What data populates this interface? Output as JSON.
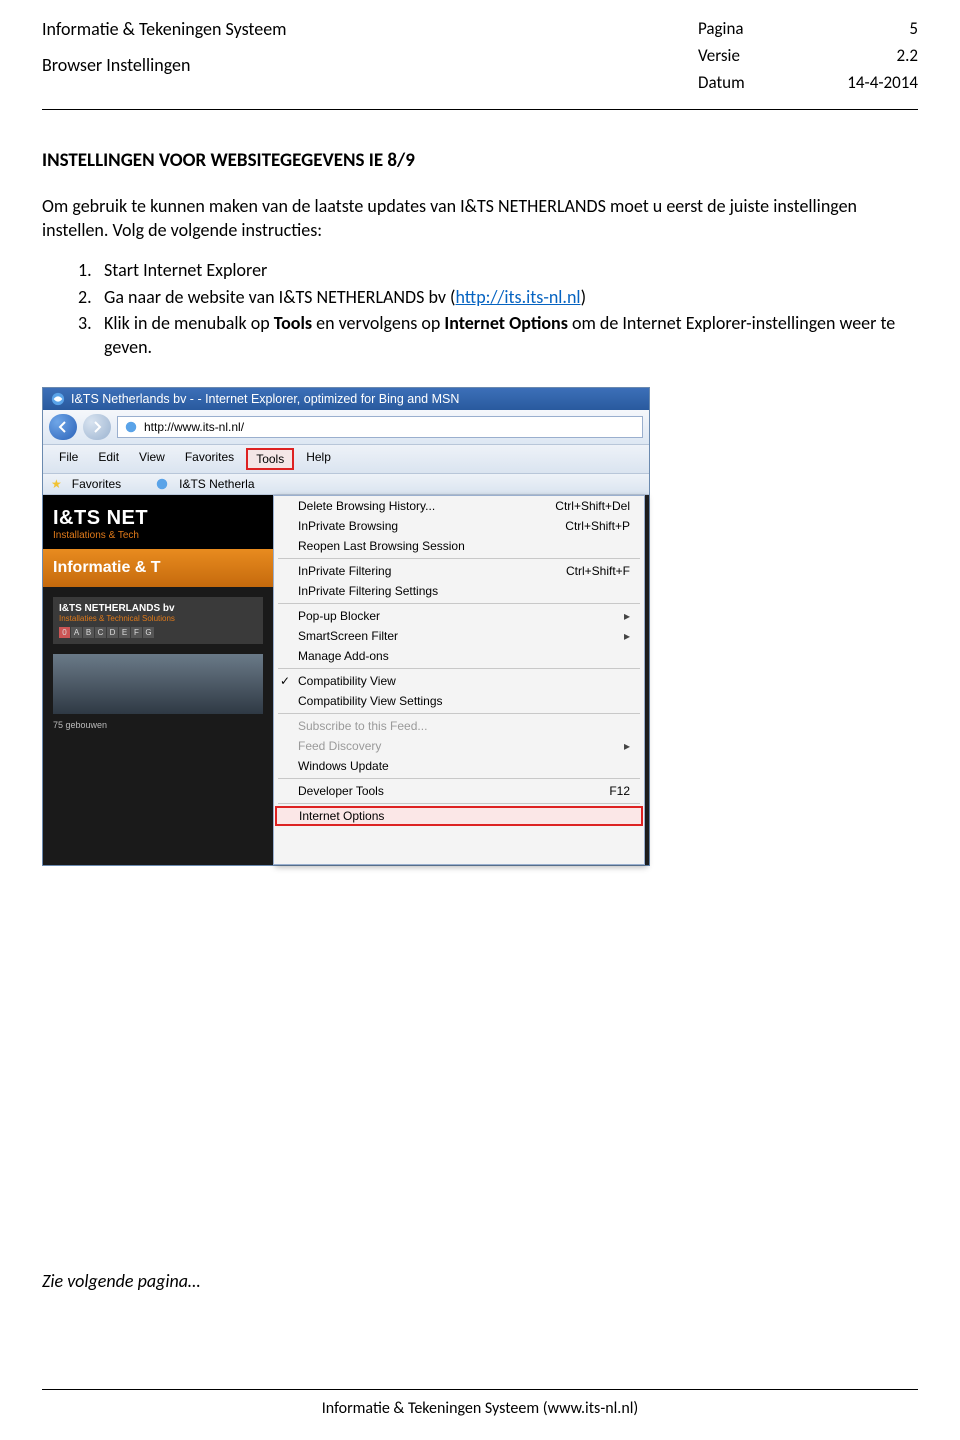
{
  "header": {
    "system": "Informatie & Tekeningen Systeem",
    "subtitle": "Browser Instellingen",
    "rows": [
      {
        "label": "Pagina",
        "value": "5"
      },
      {
        "label": "Versie",
        "value": "2.2"
      },
      {
        "label": "Datum",
        "value": "14-4-2014"
      }
    ]
  },
  "section": {
    "heading": "INSTELLINGEN VOOR WEBSITEGEGEVENS IE 8/9",
    "intro": "Om gebruik te kunnen maken van de laatste updates van I&TS NETHERLANDS moet u eerst de juiste instellingen instellen. Volg de volgende instructies:",
    "steps": {
      "s1": "Start Internet Explorer",
      "s2_pre": "Ga naar de website van I&TS NETHERLANDS bv (",
      "s2_link": "http://its.its-nl.nl",
      "s2_post": ")",
      "s3_a": "Klik in de menubalk op ",
      "s3_b": "Tools",
      "s3_c": " en vervolgens op ",
      "s3_d": "Internet Options",
      "s3_e": " om de Internet Explorer-instellingen weer te geven."
    }
  },
  "ie": {
    "title": "I&TS Netherlands bv - - Internet Explorer, optimized for Bing and MSN",
    "url": "http://www.its-nl.nl/",
    "menubar": [
      "File",
      "Edit",
      "View",
      "Favorites",
      "Tools",
      "Help"
    ],
    "favbar": {
      "fav": "Favorites",
      "tab": "I&TS Netherla"
    },
    "page": {
      "logo": "I&TS NET",
      "logo_sub": "Installations & Tech",
      "orange": "Informatie & T",
      "grey_title": "I&TS NETHERLANDS bv",
      "grey_sub": "Installaties & Technical Solutions",
      "codes": [
        "0",
        "A",
        "B",
        "C",
        "D",
        "E",
        "F",
        "G"
      ],
      "caption": "75 gebouwen"
    },
    "tools": [
      {
        "label": "Delete Browsing History...",
        "shortcut": "Ctrl+Shift+Del"
      },
      {
        "label": "InPrivate Browsing",
        "shortcut": "Ctrl+Shift+P"
      },
      {
        "label": "Reopen Last Browsing Session",
        "shortcut": ""
      },
      {
        "hr": true
      },
      {
        "label": "InPrivate Filtering",
        "shortcut": "Ctrl+Shift+F"
      },
      {
        "label": "InPrivate Filtering Settings",
        "shortcut": ""
      },
      {
        "hr": true
      },
      {
        "label": "Pop-up Blocker",
        "sub": true
      },
      {
        "label": "SmartScreen Filter",
        "sub": true
      },
      {
        "label": "Manage Add-ons",
        "shortcut": ""
      },
      {
        "hr": true
      },
      {
        "label": "Compatibility View",
        "chk": true
      },
      {
        "label": "Compatibility View Settings",
        "shortcut": ""
      },
      {
        "hr": true
      },
      {
        "label": "Subscribe to this Feed...",
        "disabled": true
      },
      {
        "label": "Feed Discovery",
        "disabled": true,
        "sub": true
      },
      {
        "label": "Windows Update",
        "shortcut": ""
      },
      {
        "hr": true
      },
      {
        "label": "Developer Tools",
        "shortcut": "F12"
      },
      {
        "hr": true
      },
      {
        "label": "Internet Options",
        "highlight": true
      }
    ]
  },
  "next": "Zie volgende pagina…",
  "footer": "Informatie & Tekeningen Systeem (www.its-nl.nl)"
}
